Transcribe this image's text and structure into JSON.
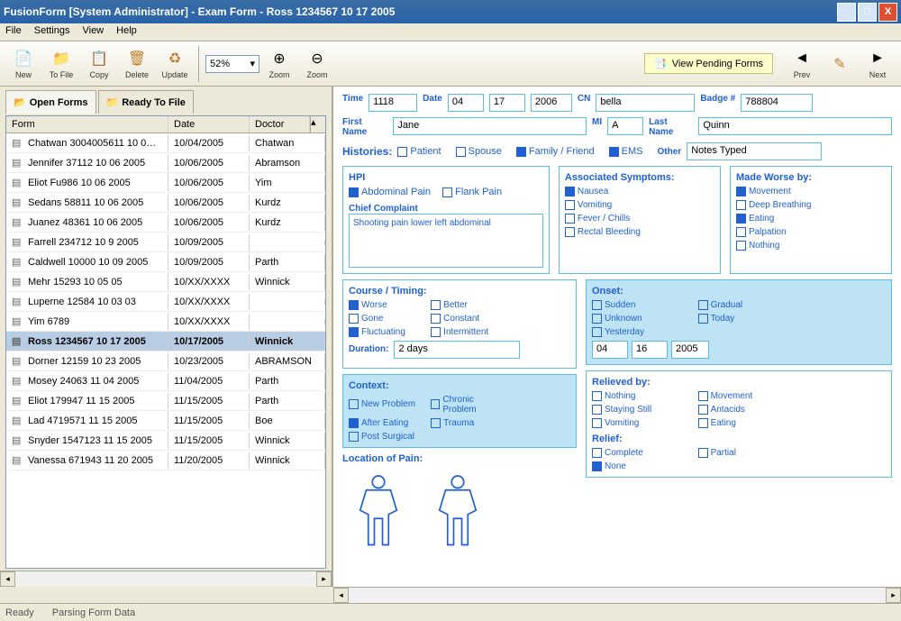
{
  "window": {
    "title": "FusionForm [System Administrator] - Exam Form - Ross 1234567 10 17 2005"
  },
  "menu": {
    "file": "File",
    "settings": "Settings",
    "view": "View",
    "help": "Help"
  },
  "toolbar": {
    "new": "New",
    "tofile": "To File",
    "copy": "Copy",
    "delete": "Delete",
    "update": "Update",
    "zoom_val": "52%",
    "zoom_in": "Zoom",
    "zoom_out": "Zoom",
    "pending": "View Pending Forms",
    "prev": "Prev",
    "edit": "",
    "next": "Next"
  },
  "tabs": {
    "open": "Open Forms",
    "ready": "Ready To File"
  },
  "grid": {
    "h1": "Form",
    "h2": "Date",
    "h3": "Doctor",
    "rows": [
      {
        "f": "Chatwan 3004005611 10 0…",
        "d": "10/04/2005",
        "dr": "Chatwan"
      },
      {
        "f": "Jennifer 37112 10 06 2005",
        "d": "10/06/2005",
        "dr": "Abramson"
      },
      {
        "f": "Eliot Fu986 10 06 2005",
        "d": "10/06/2005",
        "dr": "Yim"
      },
      {
        "f": "Sedans 58811 10 06 2005",
        "d": "10/06/2005",
        "dr": "Kurdz"
      },
      {
        "f": "Juanez 48361 10 06 2005",
        "d": "10/06/2005",
        "dr": "Kurdz"
      },
      {
        "f": "Farrell 234712 10 9 2005",
        "d": "10/09/2005",
        "dr": ""
      },
      {
        "f": "Caldwell 10000 10 09 2005",
        "d": "10/09/2005",
        "dr": "Parth"
      },
      {
        "f": "Mehr 15293 10 05 05",
        "d": "10/XX/XXXX",
        "dr": "Winnick"
      },
      {
        "f": "Luperne 12584 10 03 03",
        "d": "10/XX/XXXX",
        "dr": ""
      },
      {
        "f": "Yim 6789",
        "d": "10/XX/XXXX",
        "dr": ""
      },
      {
        "f": "Ross 1234567 10 17 2005",
        "d": "10/17/2005",
        "dr": "Winnick"
      },
      {
        "f": "Dorner 12159 10 23 2005",
        "d": "10/23/2005",
        "dr": "ABRAMSON"
      },
      {
        "f": "Mosey 24063 11 04 2005",
        "d": "11/04/2005",
        "dr": "Parth"
      },
      {
        "f": "Eliot 179947 11 15 2005",
        "d": "11/15/2005",
        "dr": "Parth"
      },
      {
        "f": "Lad 4719571 11 15 2005",
        "d": "11/15/2005",
        "dr": "Boe"
      },
      {
        "f": "Snyder 1547123 11 15 2005",
        "d": "11/15/2005",
        "dr": "Winnick"
      },
      {
        "f": "Vanessa 671943 11 20 2005",
        "d": "11/20/2005",
        "dr": "Winnick"
      }
    ],
    "selected": 10
  },
  "form": {
    "time_l": "Time",
    "time": "1118",
    "date_l": "Date",
    "date_m": "04",
    "date_d": "17",
    "date_y": "2006",
    "cn_l": "CN",
    "cn": "bella",
    "badge_l": "Badge #",
    "badge": "788804",
    "first_l": "First Name",
    "first": "Jane",
    "mi_l": "MI",
    "mi": "A",
    "last_l": "Last Name",
    "last": "Quinn",
    "hist_l": "Histories:",
    "hist_patient": "Patient",
    "hist_spouse": "Spouse",
    "hist_family": "Family / Friend",
    "hist_ems": "EMS",
    "hist_other_l": "Other",
    "hist_other": "Notes Typed",
    "hpi": "HPI",
    "hpi_cb1": "Abdominal Pain",
    "hpi_cb2": "Flank Pain",
    "chief_l": "Chief Complaint",
    "chief": "Shooting pain lower left abdominal",
    "assoc_l": "Associated Symptoms:",
    "assoc": [
      "Nausea",
      "Vomiting",
      "Fever / Chills",
      "Rectal Bleeding"
    ],
    "worse_l": "Made Worse by:",
    "worse": [
      "Movement",
      "Deep Breathing",
      "Eating",
      "Palpation",
      "Nothing"
    ],
    "course_l": "Course / Timing:",
    "ct": [
      "Worse",
      "Better",
      "Gone",
      "Constant",
      "Fluctuating",
      "Intermittent"
    ],
    "dur_l": "Duration:",
    "dur": "2 days",
    "onset_l": "Onset:",
    "onset": [
      "Sudden",
      "Gradual",
      "Unknown",
      "Today",
      "Yesterday"
    ],
    "onset_m": "04",
    "onset_d": "16",
    "onset_y": "2005",
    "context_l": "Context:",
    "ctx": [
      "New Problem",
      "Chronic Problem",
      "After Eating",
      "Trauma",
      "Post Surgical"
    ],
    "relieved_l": "Relieved by:",
    "rel": [
      "Nothing",
      "Movement",
      "Staying Still",
      "Antacids",
      "Vomiting",
      "Eating"
    ],
    "relief_l": "Relief:",
    "relief": [
      "Complete",
      "Partial",
      "None"
    ],
    "loc_l": "Location of Pain:"
  },
  "status": {
    "ready": "Ready",
    "parsing": "Parsing Form Data"
  }
}
